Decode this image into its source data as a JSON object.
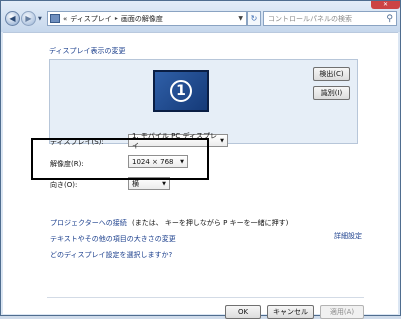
{
  "address_bar": {
    "breadcrumb_prefix": "«",
    "crumbs": [
      "ディスプレイ",
      "画面の解像度"
    ],
    "separator": "▸",
    "search_placeholder": "コントロールパネルの検索"
  },
  "main": {
    "section_title": "ディスプレイ表示の変更",
    "monitor_number": "1",
    "detect_button": "検出(C)",
    "identify_button": "識別(I)",
    "display_label": "ディスプレイ(S):",
    "display_value": "1. モバイル PC ディスプレイ",
    "resolution_label": "解像度(R):",
    "resolution_value": "1024 × 768",
    "orientation_label": "向き(O):",
    "orientation_value": "横",
    "advanced_link": "詳細設定",
    "projector_link": "プロジェクターへの接続",
    "projector_hint": "(または、 キーを押しながら P キーを一緒に押す)",
    "text_size_link": "テキストやその他の項目の大きさの変更",
    "which_settings_link": "どのディスプレイ設定を選択しますか?"
  },
  "footer": {
    "ok": "OK",
    "cancel": "キャンセル",
    "apply": "適用(A)"
  }
}
